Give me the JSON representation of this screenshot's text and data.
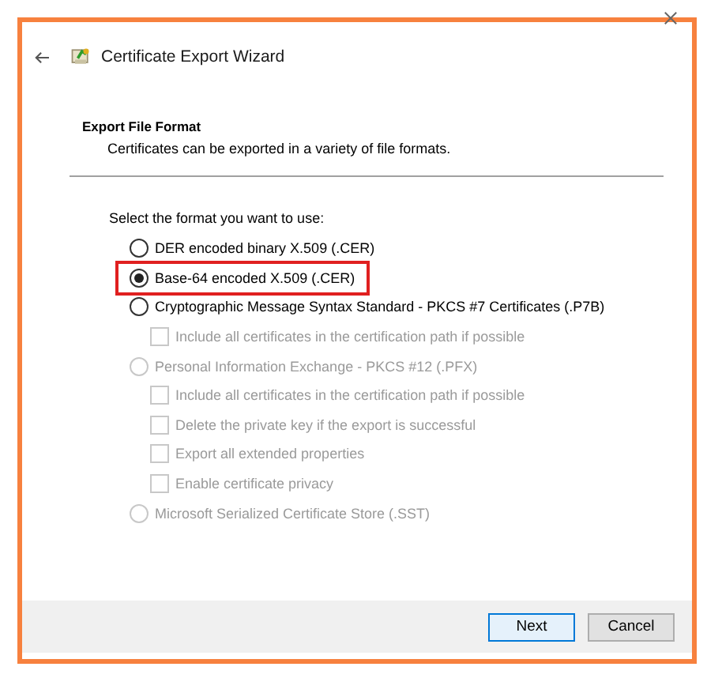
{
  "window": {
    "title": "Certificate Export Wizard"
  },
  "header": {
    "title": "Export File Format",
    "subtitle": "Certificates can be exported in a variety of file formats."
  },
  "prompt": "Select the format you want to use:",
  "options": [
    {
      "kind": "radio",
      "label": "DER encoded binary X.509 (.CER)",
      "selected": false,
      "disabled": false,
      "highlighted": false
    },
    {
      "kind": "radio",
      "label": "Base-64 encoded X.509 (.CER)",
      "selected": true,
      "disabled": false,
      "highlighted": true
    },
    {
      "kind": "radio",
      "label": "Cryptographic Message Syntax Standard - PKCS #7 Certificates (.P7B)",
      "selected": false,
      "disabled": false,
      "highlighted": false,
      "children": [
        {
          "kind": "checkbox",
          "label": "Include all certificates in the certification path if possible",
          "checked": false,
          "disabled": true
        }
      ]
    },
    {
      "kind": "radio",
      "label": "Personal Information Exchange - PKCS #12 (.PFX)",
      "selected": false,
      "disabled": true,
      "highlighted": false,
      "children": [
        {
          "kind": "checkbox",
          "label": "Include all certificates in the certification path if possible",
          "checked": false,
          "disabled": true
        },
        {
          "kind": "checkbox",
          "label": "Delete the private key if the export is successful",
          "checked": false,
          "disabled": true
        },
        {
          "kind": "checkbox",
          "label": "Export all extended properties",
          "checked": false,
          "disabled": true
        },
        {
          "kind": "checkbox",
          "label": "Enable certificate privacy",
          "checked": false,
          "disabled": true
        }
      ]
    },
    {
      "kind": "radio",
      "label": "Microsoft Serialized Certificate Store (.SST)",
      "selected": false,
      "disabled": true,
      "highlighted": false
    }
  ],
  "buttons": [
    {
      "label": "Next",
      "default": true
    },
    {
      "label": "Cancel",
      "default": false
    }
  ]
}
